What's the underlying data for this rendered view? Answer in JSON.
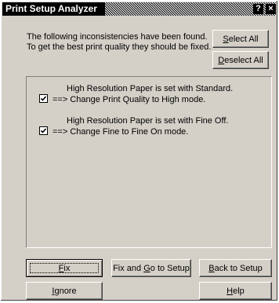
{
  "window": {
    "title": "Print Setup Analyzer",
    "help_glyph": "?",
    "close_glyph": "×"
  },
  "message": {
    "line1": "The following inconsistencies have been found.",
    "line2": "To get the best print quality they should be fixed."
  },
  "buttons": {
    "select_all": {
      "mnemonic": "S",
      "rest": "elect All"
    },
    "deselect_all": {
      "mnemonic": "D",
      "rest": "eselect All"
    },
    "fix": {
      "mnemonic": "F",
      "rest": "ix"
    },
    "fix_and_go": {
      "before": "Fix and ",
      "mnemonic": "G",
      "rest": "o to Setup"
    },
    "back_to_setup": {
      "mnemonic": "B",
      "rest": "ack to Setup"
    },
    "ignore": {
      "mnemonic": "I",
      "rest": "gnore"
    },
    "help": {
      "mnemonic": "H",
      "rest": "elp"
    }
  },
  "issues": [
    {
      "description": "High Resolution Paper is set with Standard.",
      "action": "==> Change Print Quality to High mode.",
      "checked": true
    },
    {
      "description": "High Resolution Paper is set with Fine Off.",
      "action": "==> Change Fine to Fine On mode.",
      "checked": true
    }
  ]
}
